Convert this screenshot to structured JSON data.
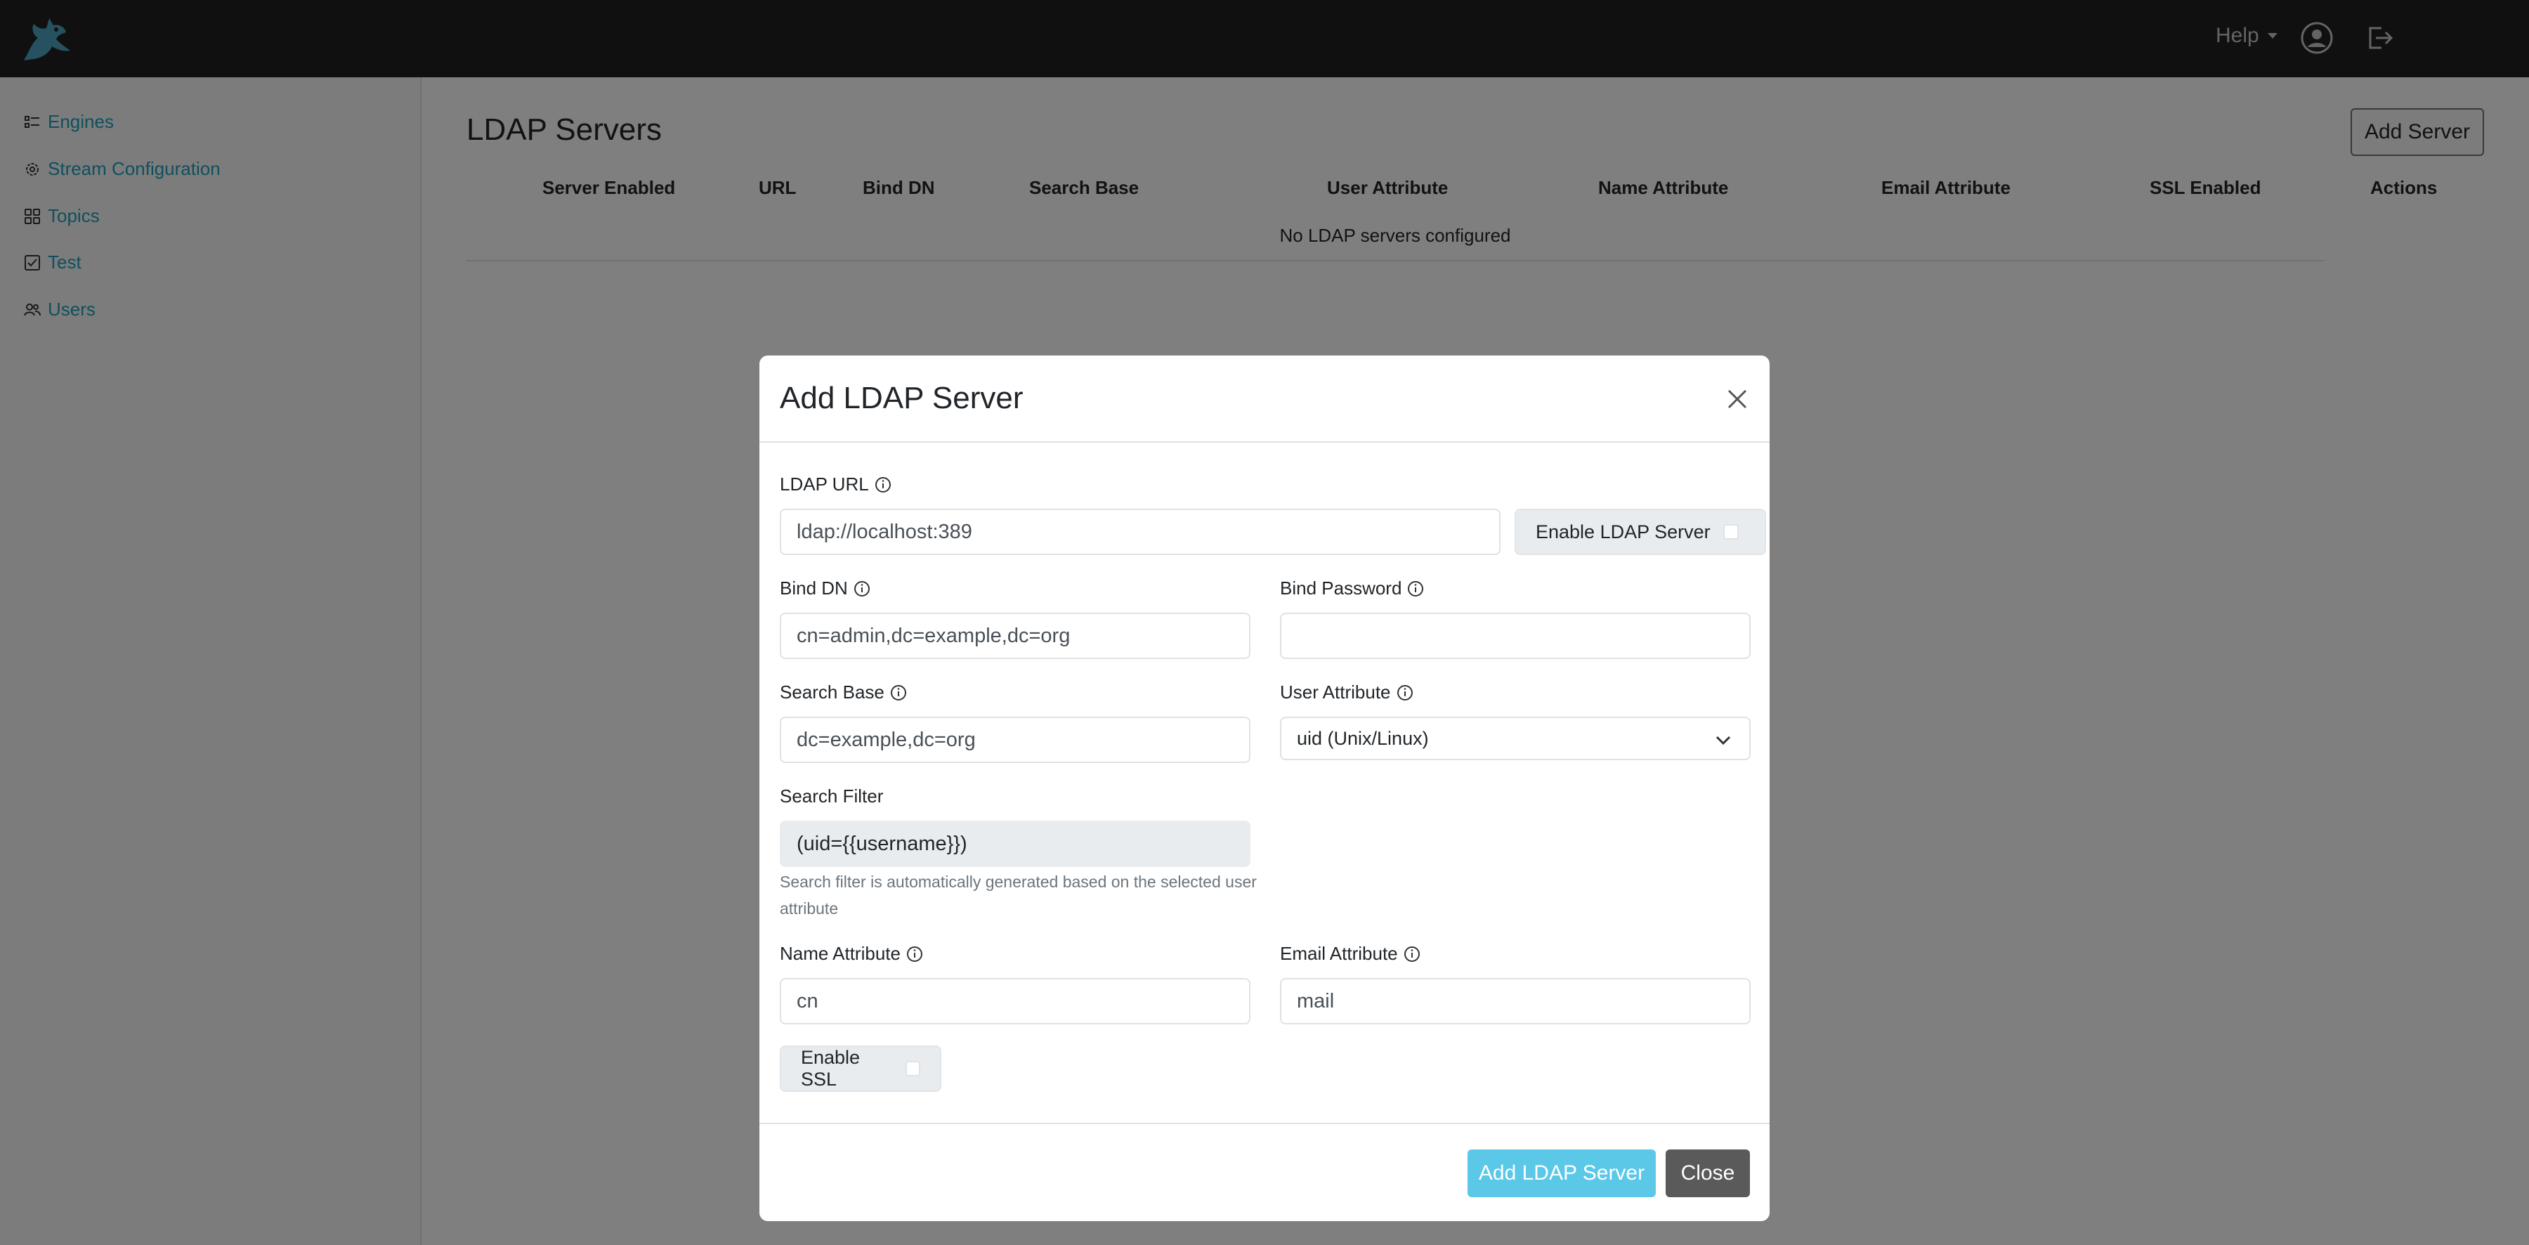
{
  "navbar": {
    "help_label": "Help"
  },
  "sidebar": {
    "items": [
      {
        "label": "Engines",
        "icon": "list-icon"
      },
      {
        "label": "Stream Configuration",
        "icon": "gear-icon"
      },
      {
        "label": "Topics",
        "icon": "grid-icon"
      },
      {
        "label": "Test",
        "icon": "check-square-icon"
      },
      {
        "label": "Users",
        "icon": "users-icon"
      }
    ]
  },
  "main": {
    "title": "LDAP Servers",
    "add_button": "Add Server",
    "columns": [
      "Server Enabled",
      "URL",
      "Bind DN",
      "Search Base",
      "User Attribute",
      "Name Attribute",
      "Email Attribute",
      "SSL Enabled",
      "Actions"
    ],
    "empty_message": "No LDAP servers configured"
  },
  "modal": {
    "title": "Add LDAP Server",
    "ldap_url": {
      "label": "LDAP URL",
      "placeholder": "ldap://localhost:389"
    },
    "enable_server_label": "Enable LDAP Server",
    "bind_dn": {
      "label": "Bind DN",
      "placeholder": "cn=admin,dc=example,dc=org"
    },
    "bind_password": {
      "label": "Bind Password",
      "value": ""
    },
    "search_base": {
      "label": "Search Base",
      "placeholder": "dc=example,dc=org"
    },
    "user_attribute": {
      "label": "User Attribute",
      "selected": "uid (Unix/Linux)"
    },
    "search_filter": {
      "label": "Search Filter",
      "value": "(uid={{username}})",
      "help": "Search filter is automatically generated based on the selected user attribute"
    },
    "name_attribute": {
      "label": "Name Attribute",
      "placeholder": "cn"
    },
    "email_attribute": {
      "label": "Email Attribute",
      "placeholder": "mail"
    },
    "enable_ssl_label": "Enable SSL",
    "submit_label": "Add LDAP Server",
    "close_label": "Close"
  },
  "colors": {
    "navbar_bg": "#212121",
    "link": "#20a0b8",
    "primary_button": "#5bc8e8",
    "secondary_button": "#5a5a5a"
  }
}
